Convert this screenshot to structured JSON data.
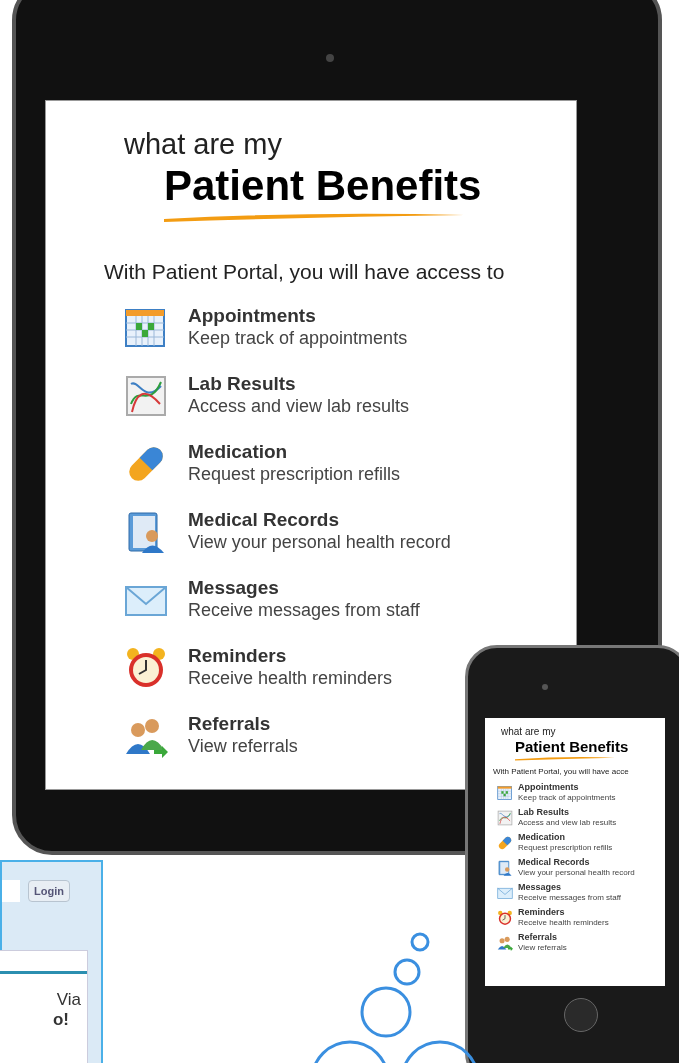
{
  "tablet": {
    "screen": {
      "kicker": "what are my",
      "title": "Patient Benefits",
      "intro": "With Patient Portal, you will have access to",
      "items": [
        {
          "title": "Appointments",
          "description": "Keep track of appointments"
        },
        {
          "title": "Lab Results",
          "description": "Access and view lab results"
        },
        {
          "title": "Medication",
          "description": "Request prescription refills"
        },
        {
          "title": "Medical Records",
          "description": "View your personal health record"
        },
        {
          "title": "Messages",
          "description": "Receive messages from staff"
        },
        {
          "title": "Reminders",
          "description": "Receive health reminders"
        },
        {
          "title": "Referrals",
          "description": "View referrals"
        }
      ]
    }
  },
  "phone": {
    "screen": {
      "kicker": "what are my",
      "title": "Patient Benefits",
      "intro": "With Patient Portal, you will have acce",
      "items": [
        {
          "title": "Appointments",
          "description": "Keep track of appointments"
        },
        {
          "title": "Lab Results",
          "description": "Access and view lab results"
        },
        {
          "title": "Medication",
          "description": "Request prescription refills"
        },
        {
          "title": "Medical Records",
          "description": "View your personal health record"
        },
        {
          "title": "Messages",
          "description": "Receive messages from staff"
        },
        {
          "title": "Reminders",
          "description": "Receive health reminders"
        },
        {
          "title": "Referrals",
          "description": "View referrals"
        }
      ]
    }
  },
  "login_window": {
    "button": "Login",
    "heading_fragment": "Via",
    "heading_fragment_2": "o!"
  }
}
